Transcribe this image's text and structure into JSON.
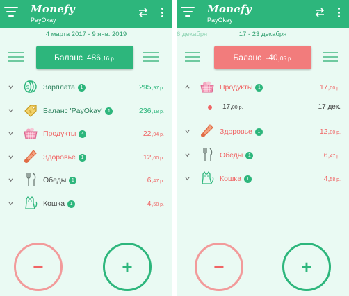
{
  "colors": {
    "green": "#2db67c",
    "red": "#f06464",
    "balance_negative": "#f27c7c",
    "text_dark": "#444444"
  },
  "left": {
    "appbar": {
      "logo": "Monefy",
      "account": "PayOkay"
    },
    "period": {
      "label": "4 марта 2017 - 9 янв. 2019"
    },
    "balance": {
      "label": "Баланс",
      "int": "486,",
      "dec": "16 р."
    },
    "categories": [
      {
        "name": "Зарплата",
        "badge": "1",
        "amount_int": "295,",
        "amount_dec": "97 р.",
        "kind": "income",
        "icon": "coins-icon"
      },
      {
        "name": "Баланс 'PayOkay'",
        "badge": "1",
        "amount_int": "236,",
        "amount_dec": "18 р.",
        "kind": "transfer",
        "icon": "tag-icon"
      },
      {
        "name": "Продукты",
        "badge": "4",
        "amount_int": "22,",
        "amount_dec": "94 р.",
        "kind": "expense",
        "icon": "basket-icon"
      },
      {
        "name": "Здоровье",
        "badge": "1",
        "amount_int": "12,",
        "amount_dec": "00 р.",
        "kind": "expense",
        "icon": "thermometer-icon"
      },
      {
        "name": "Обеды",
        "badge": "1",
        "amount_int": "6,",
        "amount_dec": "47 р.",
        "kind": "expense",
        "icon": "cutlery-icon"
      },
      {
        "name": "Кошка",
        "badge": "1",
        "amount_int": "4,",
        "amount_dec": "58 р.",
        "kind": "expense",
        "icon": "cat-icon"
      }
    ],
    "fab_minus": "−",
    "fab_plus": "+"
  },
  "right": {
    "appbar": {
      "logo": "Monefy",
      "account": "PayOkay"
    },
    "period": {
      "prev": "6 декабря",
      "label": "17 - 23 декабря"
    },
    "balance": {
      "label": "Баланс",
      "int": "-40,",
      "dec": "05 р."
    },
    "categories": [
      {
        "name": "Продукты",
        "badge": "1",
        "amount_int": "17,",
        "amount_dec": "00 р.",
        "kind": "expense",
        "icon": "basket-icon",
        "expanded": true
      },
      {
        "name": "Здоровье",
        "badge": "1",
        "amount_int": "12,",
        "amount_dec": "00 р.",
        "kind": "expense",
        "icon": "thermometer-icon"
      },
      {
        "name": "Обеды",
        "badge": "1",
        "amount_int": "6,",
        "amount_dec": "47 р.",
        "kind": "expense",
        "icon": "cutlery-icon"
      },
      {
        "name": "Кошка",
        "badge": "1",
        "amount_int": "4,",
        "amount_dec": "58 р.",
        "kind": "expense",
        "icon": "cat-icon"
      }
    ],
    "transaction": {
      "amount_int": "17,",
      "amount_dec": "00 р.",
      "date": "17 дек."
    },
    "fab_minus": "−",
    "fab_plus": "+"
  }
}
